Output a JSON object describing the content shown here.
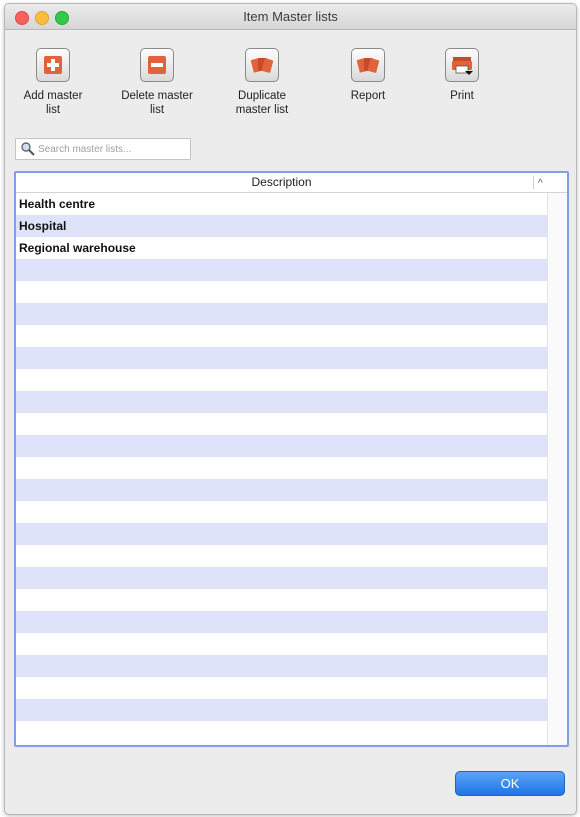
{
  "window": {
    "title": "Item Master lists"
  },
  "toolbar": {
    "add": {
      "label_line1": "Add master",
      "label_line2": "list",
      "icon": "plus-icon"
    },
    "delete": {
      "label_line1": "Delete master",
      "label_line2": "list",
      "icon": "minus-icon"
    },
    "duplicate": {
      "label_line1": "Duplicate",
      "label_line2": "master list",
      "icon": "cards-icon"
    },
    "report": {
      "label_line1": "Report",
      "icon": "cards-icon"
    },
    "print": {
      "label_line1": "Print",
      "icon": "printer-icon"
    }
  },
  "search": {
    "placeholder": "Search master lists...",
    "value": ""
  },
  "table": {
    "columns": [
      "Description"
    ],
    "rows": [
      "Health centre",
      "Hospital",
      "Regional warehouse"
    ],
    "sort": "ascending"
  },
  "footer": {
    "ok_label": "OK"
  },
  "colors": {
    "row_stripe": "#dfe3fa",
    "accent": "#1f75e6",
    "table_border": "#7fa0e6"
  }
}
